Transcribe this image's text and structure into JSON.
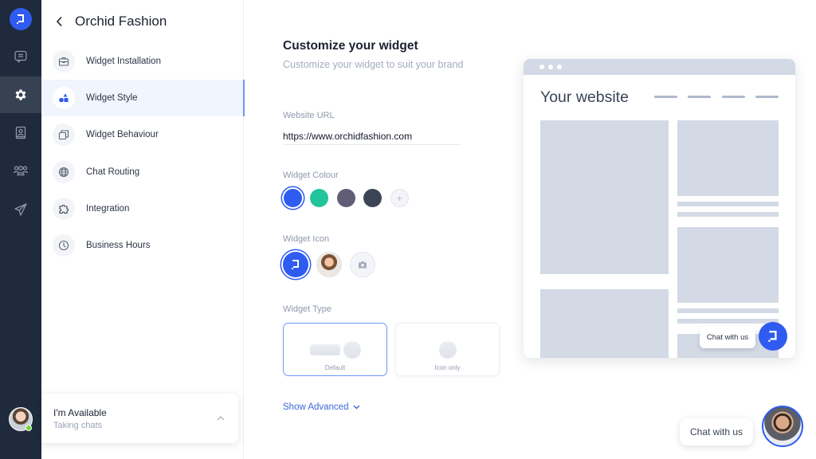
{
  "rail": {
    "items": [
      {
        "name": "chats",
        "icon": "chat-icon"
      },
      {
        "name": "settings",
        "icon": "gear-icon",
        "active": true
      },
      {
        "name": "contacts",
        "icon": "contact-book-icon"
      },
      {
        "name": "team",
        "icon": "team-icon"
      },
      {
        "name": "campaigns",
        "icon": "paper-plane-icon"
      }
    ]
  },
  "sidebar": {
    "back_icon": "chevron-left-icon",
    "title": "Orchid Fashion",
    "items": [
      {
        "label": "Widget Installation",
        "icon": "briefcase-icon"
      },
      {
        "label": "Widget Style",
        "icon": "shapes-icon",
        "active": true
      },
      {
        "label": "Widget Behaviour",
        "icon": "windows-icon"
      },
      {
        "label": "Chat Routing",
        "icon": "globe-icon"
      },
      {
        "label": "Integration",
        "icon": "puzzle-icon"
      },
      {
        "label": "Business Hours",
        "icon": "clock-icon"
      }
    ],
    "status": {
      "title": "I'm Available",
      "subtitle": "Taking chats",
      "indicator_color": "#6fd63a"
    }
  },
  "main": {
    "title": "Customize your widget",
    "subtitle": "Customize your widget to suit your brand",
    "website_url": {
      "label": "Website URL",
      "value": "https://www.orchidfashion.com"
    },
    "widget_colour": {
      "label": "Widget Colour",
      "options": [
        "#2f5bf0",
        "#22c59a",
        "#605d75",
        "#3b4556"
      ],
      "selected": "#2f5bf0",
      "add_label": "+"
    },
    "widget_icon": {
      "label": "Widget Icon",
      "options": [
        "logo",
        "photo",
        "upload"
      ],
      "selected": "logo"
    },
    "widget_type": {
      "label": "Widget Type",
      "options": [
        {
          "label": "Default",
          "selected": true
        },
        {
          "label": "Icon only",
          "selected": false
        }
      ]
    },
    "show_advanced": "Show Advanced"
  },
  "preview": {
    "site_title": "Your website",
    "mini_chat_label": "Chat with us"
  },
  "chat_launcher": {
    "label": "Chat with us"
  }
}
